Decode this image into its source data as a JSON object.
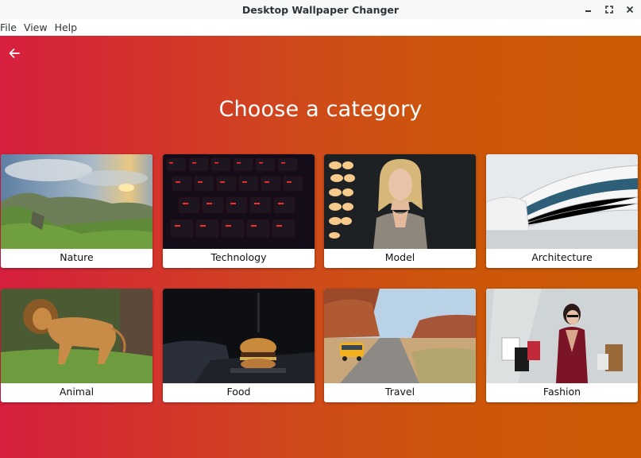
{
  "window": {
    "title": "Desktop Wallpaper Changer"
  },
  "menu": {
    "items": [
      {
        "label": "File"
      },
      {
        "label": "View"
      },
      {
        "label": "Help"
      }
    ]
  },
  "page": {
    "heading": "Choose a category"
  },
  "categories": [
    {
      "label": "Nature"
    },
    {
      "label": "Technology"
    },
    {
      "label": "Model"
    },
    {
      "label": "Architecture"
    },
    {
      "label": "Animal"
    },
    {
      "label": "Food"
    },
    {
      "label": "Travel"
    },
    {
      "label": "Fashion"
    }
  ],
  "colors": {
    "gradient_start": "#d61f3e",
    "gradient_end": "#cb5b05"
  }
}
